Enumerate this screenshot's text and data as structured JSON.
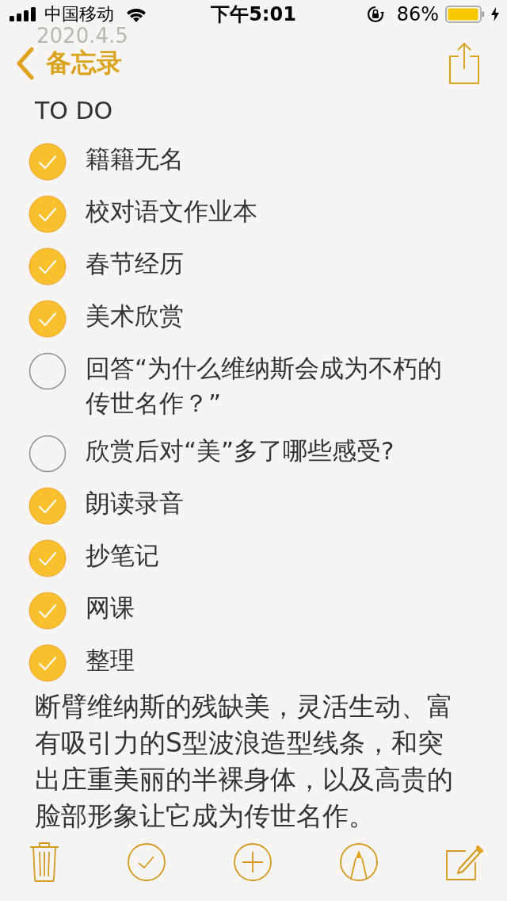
{
  "status_bar": {
    "carrier": "中国移动",
    "time": "下午5:01",
    "battery_percent": "86%",
    "charging": true
  },
  "date": "2020.4.5",
  "nav": {
    "back_label": "备忘录"
  },
  "heading": "TO DO",
  "checklist": [
    {
      "text": "籍籍无名",
      "checked": true
    },
    {
      "text": "校对语文作业本",
      "checked": true
    },
    {
      "text": "春节经历",
      "checked": true
    },
    {
      "text": "美术欣赏",
      "checked": true
    },
    {
      "text": "回答“为什么维纳斯会成为不朽的传世名作？”",
      "checked": false
    },
    {
      "text": "欣赏后对“美”多了哪些感受?",
      "checked": false
    },
    {
      "text": "朗读录音",
      "checked": true
    },
    {
      "text": "抄笔记",
      "checked": true
    },
    {
      "text": "网课",
      "checked": true
    },
    {
      "text": "整理",
      "checked": true
    }
  ],
  "paragraph": "断臂维纳斯的残缺美，灵活生动、富有吸引力的S型波浪造型线条，和突出庄重美丽的半裸身体，以及高贵的脸部形象让它成为传世名作。"
}
